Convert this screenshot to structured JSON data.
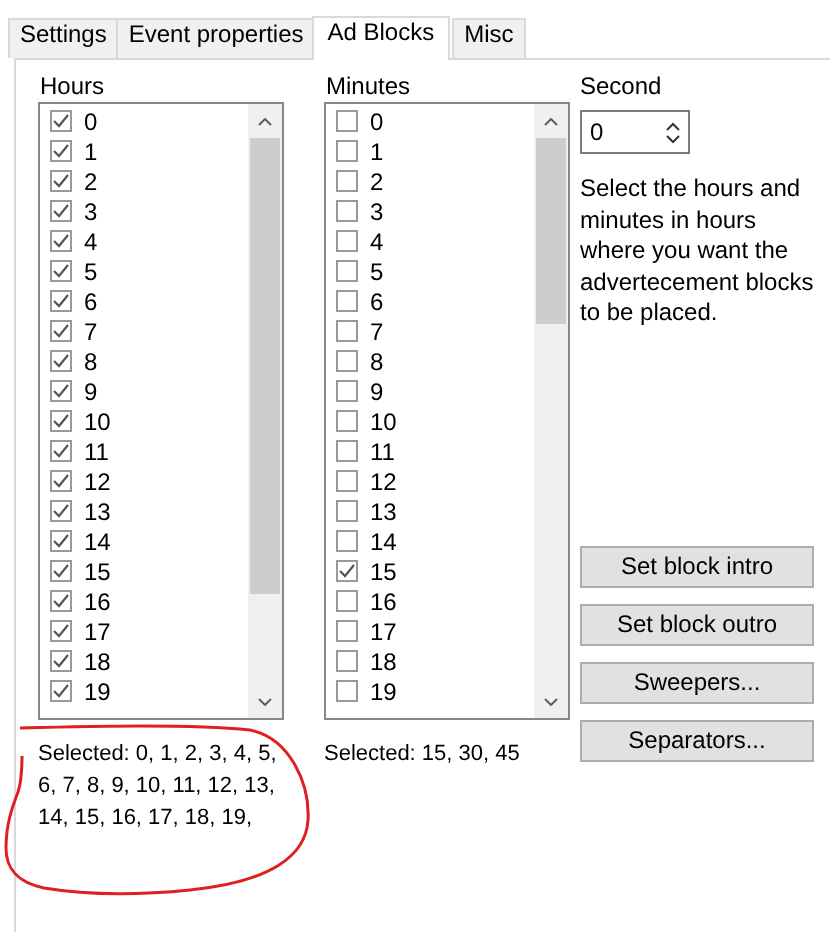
{
  "tabs": [
    {
      "label": "Settings",
      "selected": false
    },
    {
      "label": "Event properties",
      "selected": false
    },
    {
      "label": "Ad Blocks",
      "selected": true
    },
    {
      "label": "Misc",
      "selected": false
    }
  ],
  "hours": {
    "label": "Hours",
    "items": [
      {
        "label": "0",
        "checked": true
      },
      {
        "label": "1",
        "checked": true
      },
      {
        "label": "2",
        "checked": true
      },
      {
        "label": "3",
        "checked": true
      },
      {
        "label": "4",
        "checked": true
      },
      {
        "label": "5",
        "checked": true
      },
      {
        "label": "6",
        "checked": true
      },
      {
        "label": "7",
        "checked": true
      },
      {
        "label": "8",
        "checked": true
      },
      {
        "label": "9",
        "checked": true
      },
      {
        "label": "10",
        "checked": true
      },
      {
        "label": "11",
        "checked": true
      },
      {
        "label": "12",
        "checked": true
      },
      {
        "label": "13",
        "checked": true
      },
      {
        "label": "14",
        "checked": true
      },
      {
        "label": "15",
        "checked": true
      },
      {
        "label": "16",
        "checked": true
      },
      {
        "label": "17",
        "checked": true
      },
      {
        "label": "18",
        "checked": true
      },
      {
        "label": "19",
        "checked": true
      }
    ],
    "selected_text": "Selected: 0, 1, 2, 3, 4, 5, 6, 7, 8, 9, 10, 11, 12, 13, 14, 15, 16, 17, 18, 19,"
  },
  "minutes": {
    "label": "Minutes",
    "items": [
      {
        "label": "0",
        "checked": false
      },
      {
        "label": "1",
        "checked": false
      },
      {
        "label": "2",
        "checked": false
      },
      {
        "label": "3",
        "checked": false
      },
      {
        "label": "4",
        "checked": false
      },
      {
        "label": "5",
        "checked": false
      },
      {
        "label": "6",
        "checked": false
      },
      {
        "label": "7",
        "checked": false
      },
      {
        "label": "8",
        "checked": false
      },
      {
        "label": "9",
        "checked": false
      },
      {
        "label": "10",
        "checked": false
      },
      {
        "label": "11",
        "checked": false
      },
      {
        "label": "12",
        "checked": false
      },
      {
        "label": "13",
        "checked": false
      },
      {
        "label": "14",
        "checked": false
      },
      {
        "label": "15",
        "checked": true
      },
      {
        "label": "16",
        "checked": false
      },
      {
        "label": "17",
        "checked": false
      },
      {
        "label": "18",
        "checked": false
      },
      {
        "label": "19",
        "checked": false
      }
    ],
    "selected_text": "Selected: 15, 30, 45"
  },
  "second": {
    "label": "Second",
    "value": "0"
  },
  "description": "Select the hours and minutes in hours where you want the advertecement blocks to be placed.",
  "buttons": [
    "Set block intro",
    "Set block outro",
    "Sweepers...",
    "Separators..."
  ]
}
